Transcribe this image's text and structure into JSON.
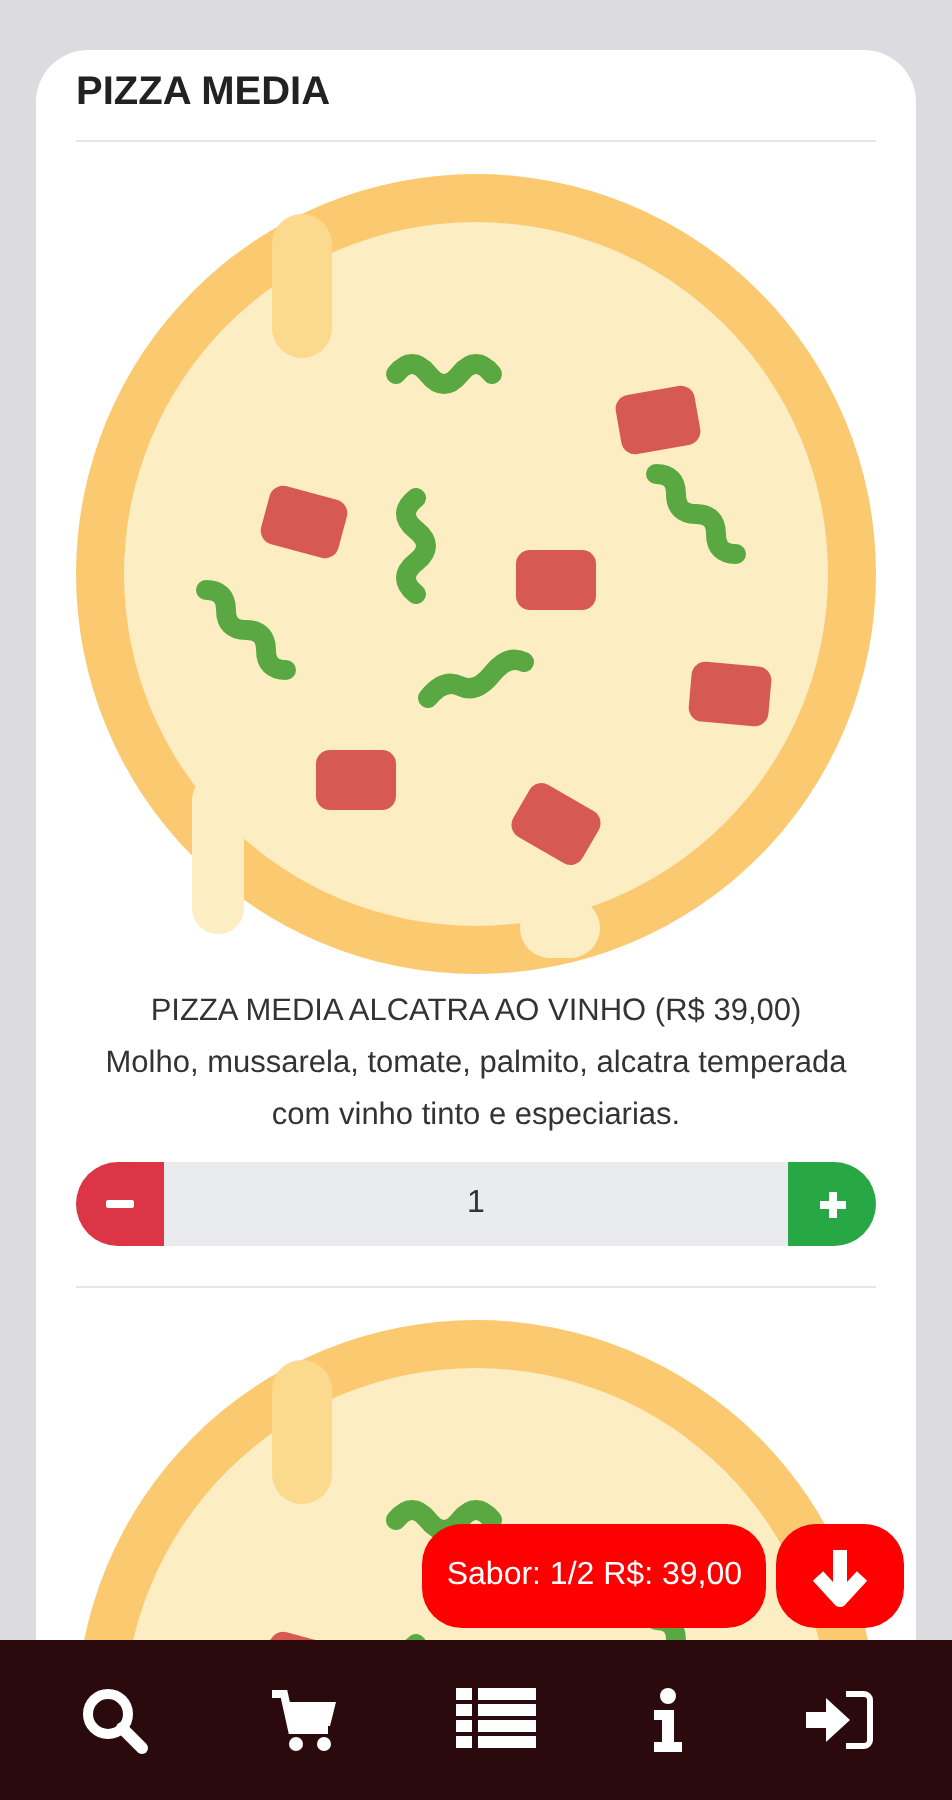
{
  "category": {
    "title": "PIZZA MEDIA"
  },
  "products": [
    {
      "kind": "full",
      "title": "PIZZA MEDIA ALCATRA AO VINHO (R$ 39,00)",
      "description": "Molho, mussarela, tomate, palmito, alcatra temperada com vinho tinto e especiarias.",
      "quantity": "1"
    },
    {
      "kind": "cut"
    }
  ],
  "order_summary": {
    "label": "Sabor: 1/2 R$: 39,00"
  }
}
